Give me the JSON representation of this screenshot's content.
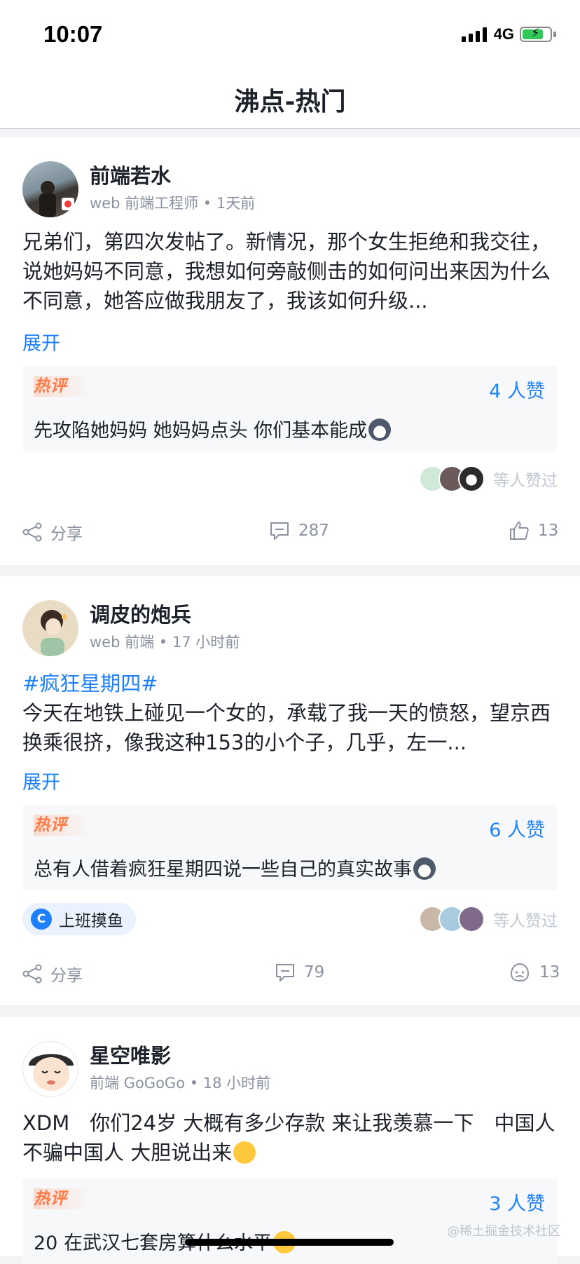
{
  "status_bar": {
    "time": "10:07",
    "network": "4G",
    "battery_level": 0.75
  },
  "nav": {
    "title": "沸点-热门"
  },
  "posts": [
    {
      "author": "前端若水",
      "meta": "web 前端工程师 • 1天前",
      "text": "兄弟们，第四次发帖了。新情况，那个女生拒绝和我交往，说她妈妈不同意，我想如何旁敲侧击的如何问出来因为什么不同意，她答应做我朋友了，我该如何升级...",
      "expand": "展开",
      "hot": {
        "badge": "热评",
        "likes": "4 人赞",
        "comment": "先攻陷她妈妈 她妈妈点头 你们基本能成"
      },
      "liked_by": "等人赞过",
      "actions": {
        "share": "分享",
        "comments": "287",
        "likes": "13"
      }
    },
    {
      "author": "调皮的炮兵",
      "meta": "web 前端 • 17 小时前",
      "hashtag": "#疯狂星期四#",
      "text": "今天在地铁上碰见一个女的，承载了我一天的愤怒，望京西换乘很挤，像我这种153的小个子，几乎，左一...",
      "expand": "展开",
      "hot": {
        "badge": "热评",
        "likes": "6 人赞",
        "comment": "总有人借着疯狂星期四说一些自己的真实故事"
      },
      "topic": "上班摸鱼",
      "liked_by": "等人赞过",
      "actions": {
        "share": "分享",
        "comments": "79",
        "likes": "13"
      }
    },
    {
      "author": "星空唯影",
      "meta": "前端 GoGoGo • 18 小时前",
      "text": "XDM　你们24岁 大概有多少存款 来让我羡慕一下　中国人不骗中国人 大胆说出来",
      "hot": {
        "badge": "热评",
        "likes": "3 人赞",
        "comment": "20 在武汉七套房算什么水平"
      }
    }
  ],
  "watermark": "@稀土掘金技术社区",
  "colors": {
    "accent": "#1e80ff",
    "hot": "#ff7a45",
    "muted": "#8a919f"
  }
}
